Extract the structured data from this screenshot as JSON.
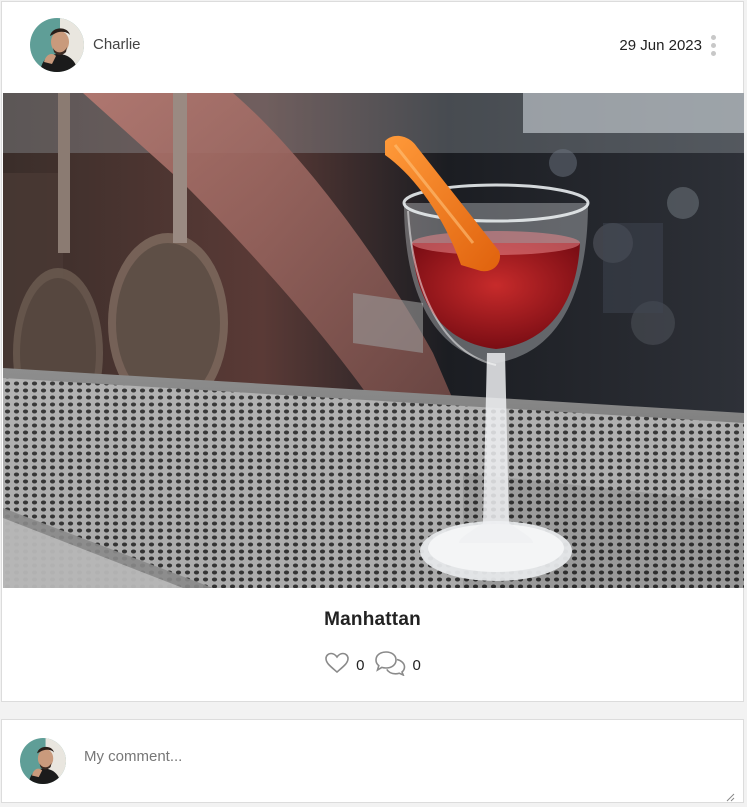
{
  "post": {
    "author": "Charlie",
    "date": "29 Jun 2023",
    "title": "Manhattan",
    "likes": "0",
    "comments": "0"
  },
  "comment_box": {
    "placeholder": "My comment..."
  },
  "icons": {
    "menu": "more-vertical-icon",
    "like": "heart-icon",
    "comment": "speech-bubbles-icon",
    "resize": "resize-grip-icon"
  }
}
